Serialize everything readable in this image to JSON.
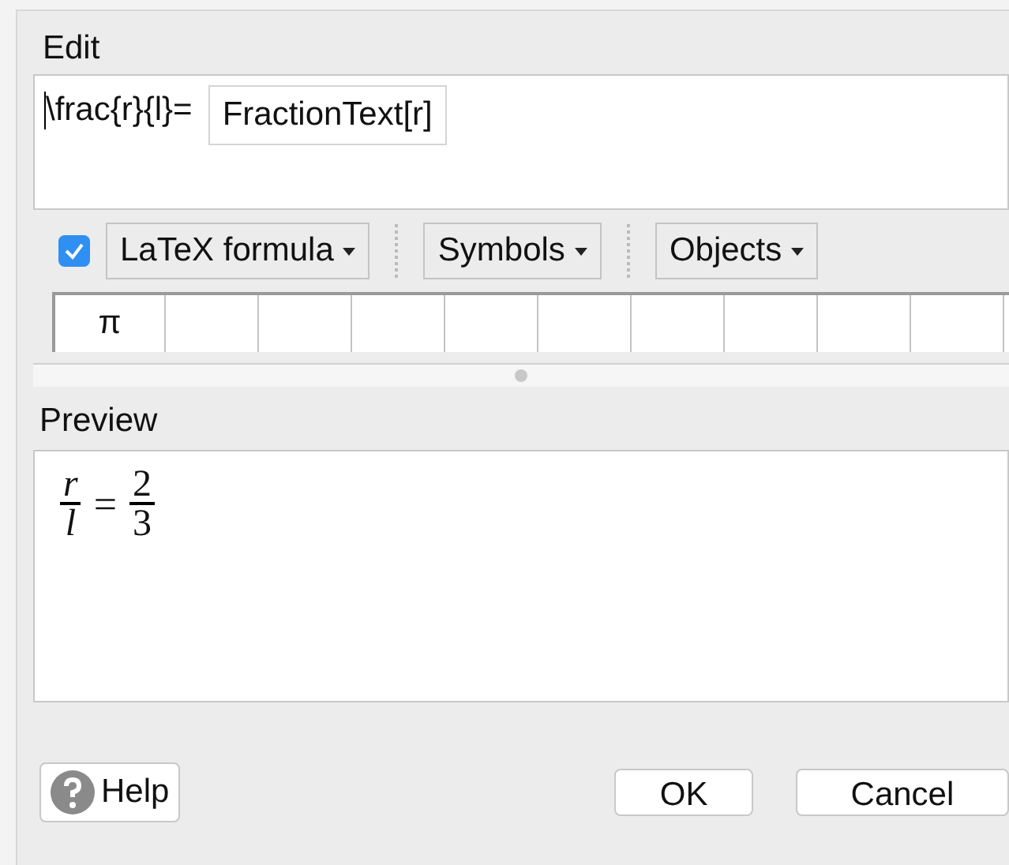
{
  "edit": {
    "label": "Edit",
    "text": "\\frac{r}{l}=",
    "object": "FractionText[r]"
  },
  "toolbar": {
    "latex_checked": true,
    "menus": [
      {
        "label": "LaTeX formula"
      },
      {
        "label": "Symbols"
      },
      {
        "label": "Objects"
      }
    ]
  },
  "symbols": [
    "π"
  ],
  "preview": {
    "label": "Preview",
    "lhs": {
      "numerator": "r",
      "denominator": "l"
    },
    "operator": "=",
    "rhs": {
      "numerator": "2",
      "denominator": "3"
    }
  },
  "buttons": {
    "help": "Help",
    "ok": "OK",
    "cancel": "Cancel"
  }
}
